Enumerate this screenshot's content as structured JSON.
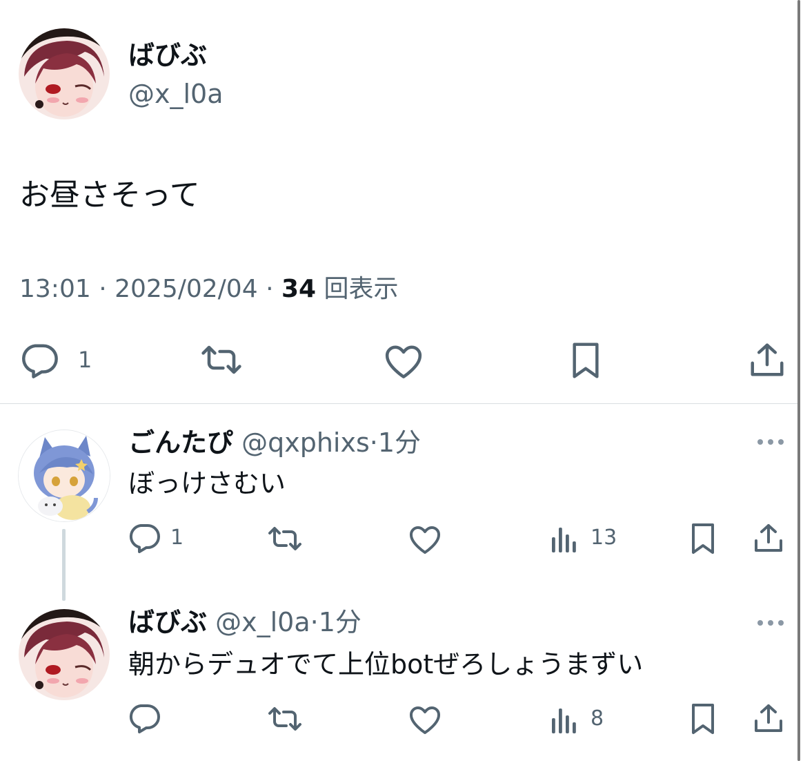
{
  "main_tweet": {
    "author": {
      "display_name": "ばびぶ",
      "handle": "@x_l0a"
    },
    "text": "お昼さそって",
    "meta": {
      "time": "13:01",
      "date": "2025/02/04",
      "views_count": "34",
      "views_label": "回表示"
    },
    "actions": {
      "reply_count": "1"
    }
  },
  "replies": [
    {
      "author": {
        "display_name": "ごんたぴ",
        "handle": "@qxphixs"
      },
      "time_ago": "1分",
      "text": "ぼっけさむい",
      "actions": {
        "reply_count": "1",
        "views_count": "13"
      }
    },
    {
      "author": {
        "display_name": "ばびぶ",
        "handle": "@x_l0a"
      },
      "time_ago": "1分",
      "text": "朝からデュオでて上位botぜろしょうまずい",
      "actions": {
        "views_count": "8"
      }
    }
  ],
  "separator": "·",
  "icons": [
    "reply-icon",
    "retweet-icon",
    "like-icon",
    "bookmark-icon",
    "share-icon",
    "views-icon",
    "more-icon"
  ],
  "colors": {
    "text": "#0f1419",
    "muted": "#536471",
    "divider": "#d9dde0",
    "thread_line": "#cfd9de"
  }
}
